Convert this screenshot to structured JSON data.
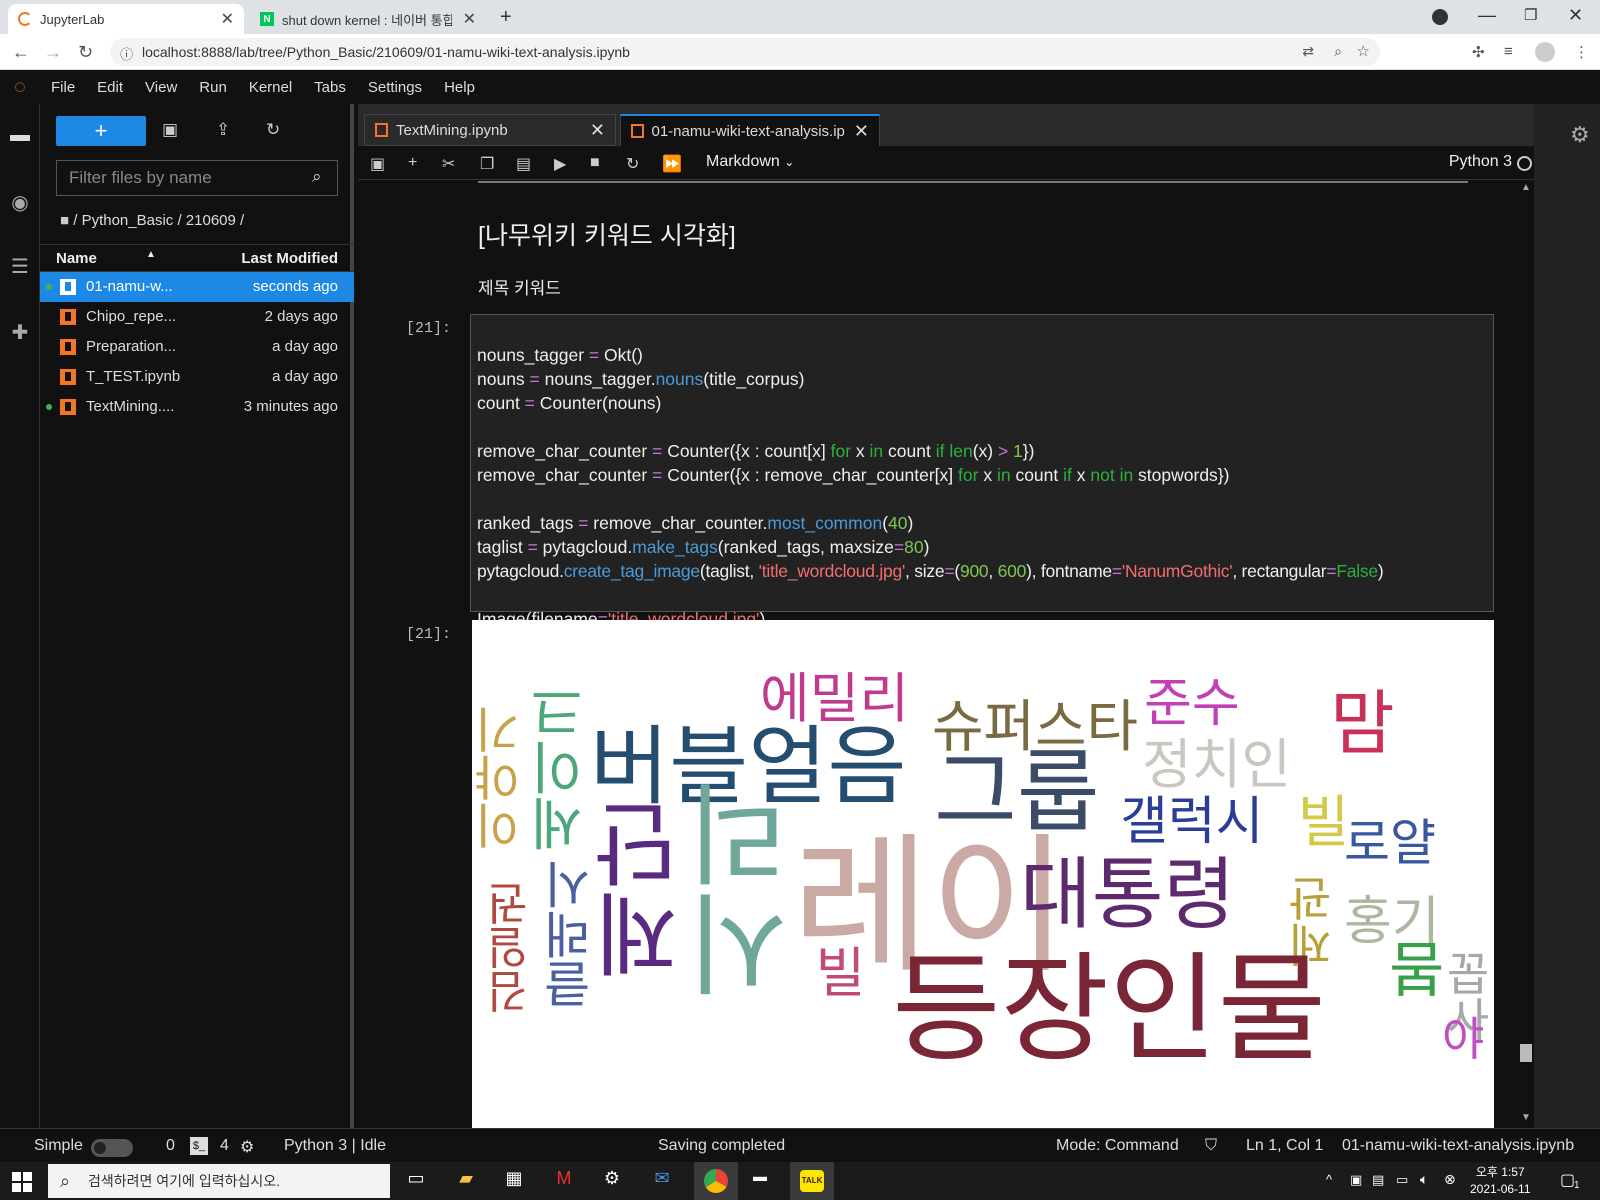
{
  "browser": {
    "tabs": [
      {
        "title": "JupyterLab",
        "icon": "jupyter-favicon"
      },
      {
        "title": "shut down kernel : 네이버 통합",
        "icon": "naver-favicon"
      }
    ],
    "url": "localhost:8888/lab/tree/Python_Basic/210609/01-namu-wiki-text-analysis.ipynb"
  },
  "menu": [
    "File",
    "Edit",
    "View",
    "Run",
    "Kernel",
    "Tabs",
    "Settings",
    "Help"
  ],
  "filebrowser": {
    "new_label": "+",
    "filter_placeholder": "Filter files by name",
    "breadcrumb": "/ Python_Basic / 210609 /",
    "col_name": "Name",
    "col_modified": "Last Modified",
    "files": [
      {
        "name": "01-namu-w...",
        "modified": "seconds ago",
        "running": true,
        "selected": true
      },
      {
        "name": "Chipo_repe...",
        "modified": "2 days ago",
        "running": false,
        "selected": false
      },
      {
        "name": "Preparation...",
        "modified": "a day ago",
        "running": false,
        "selected": false
      },
      {
        "name": "T_TEST.ipynb",
        "modified": "a day ago",
        "running": false,
        "selected": false
      },
      {
        "name": "TextMining....",
        "modified": "3 minutes ago",
        "running": true,
        "selected": false
      }
    ]
  },
  "doc_tabs": [
    {
      "title": "TextMining.ipynb"
    },
    {
      "title": "01-namu-wiki-text-analysis.ip"
    }
  ],
  "toolbar": {
    "cell_type": "Markdown",
    "kernel": "Python 3"
  },
  "notebook": {
    "heading": "[나무위키 키워드 시각화]",
    "paragraph": "제목 키워드",
    "in_prompt": "[21]:",
    "out_prompt": "[21]:",
    "code_lines": [
      "nouns_tagger = Okt()",
      "nouns = nouns_tagger.nouns(title_corpus)",
      "count = Counter(nouns)",
      "",
      "remove_char_counter = Counter({x : count[x] for x in count if len(x) > 1})",
      "remove_char_counter = Counter({x : remove_char_counter[x] for x in count if x not in stopwords})",
      "",
      "ranked_tags = remove_char_counter.most_common(40)",
      "taglist = pytagcloud.make_tags(ranked_tags, maxsize=80)",
      "pytagcloud.create_tag_image(taglist, 'title_wordcloud.jpg', size=(900, 600), fontname='NanumGothic', rectangular=False)",
      "",
      "Image(filename='title_wordcloud.jpg')"
    ],
    "wordcloud_words": [
      "에밀리",
      "슈퍼스타",
      "준수",
      "맘",
      "이야기",
      "세이크",
      "버블얼음",
      "그룹",
      "정치인",
      "갤럭시",
      "로얄",
      "빌",
      "제단",
      "시리",
      "레이",
      "대통령",
      "홍기",
      "김일권",
      "클래시",
      "제관",
      "등장인물",
      "봄",
      "빌",
      "꼽사",
      "야"
    ]
  },
  "status": {
    "mode_label": "Simple",
    "counts": [
      "0",
      "4"
    ],
    "kernel_status": "Python 3 | Idle",
    "message": "Saving completed",
    "mode": "Mode: Command",
    "position": "Ln 1, Col 1",
    "filename": "01-namu-wiki-text-analysis.ipynb"
  },
  "taskbar": {
    "search_placeholder": "검색하려면 여기에 입력하십시오.",
    "time": "오후 1:57",
    "date": "2021-06-11",
    "notif_count": "1"
  },
  "colors": {
    "accent": "#1e88e5",
    "jupyter_orange": "#f37626"
  }
}
